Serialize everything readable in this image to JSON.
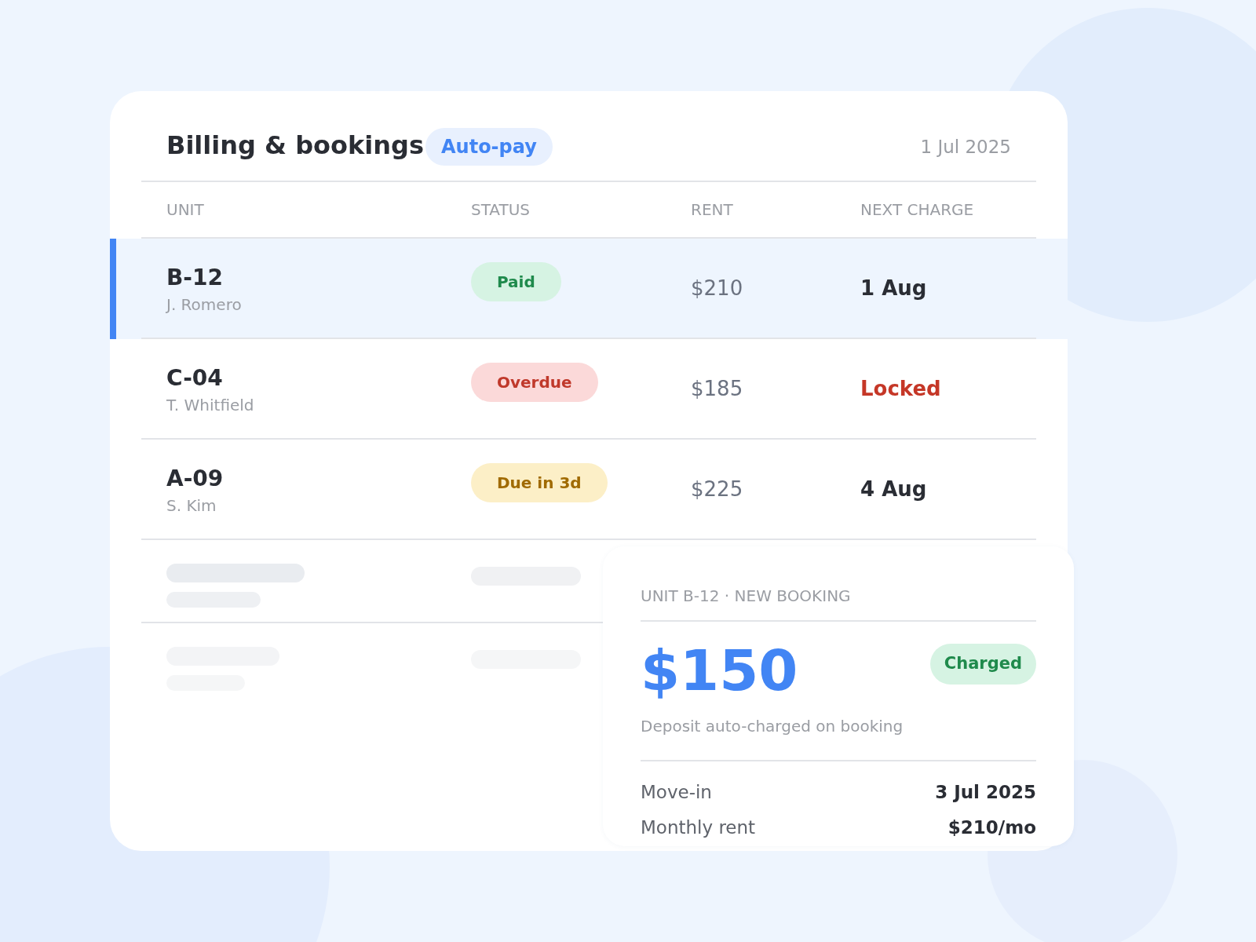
{
  "header": {
    "title": "Billing & bookings",
    "badge": "Auto-pay",
    "date": "1 Jul 2025"
  },
  "table": {
    "columns": [
      "UNIT",
      "STATUS",
      "RENT",
      "NEXT CHARGE"
    ],
    "rows": [
      {
        "unit": "B-12",
        "tenant": "J. Romero",
        "status": {
          "label": "Paid",
          "kind": "paid"
        },
        "rent": "$210",
        "next_charge": {
          "text": "1 Aug",
          "kind": "date"
        },
        "selected": true
      },
      {
        "unit": "C-04",
        "tenant": "T. Whitfield",
        "status": {
          "label": "Overdue",
          "kind": "overdue"
        },
        "rent": "$185",
        "next_charge": {
          "text": "Locked",
          "kind": "alert"
        },
        "selected": false
      },
      {
        "unit": "A-09",
        "tenant": "S. Kim",
        "status": {
          "label": "Due in 3d",
          "kind": "due"
        },
        "rent": "$225",
        "next_charge": {
          "text": "4 Aug",
          "kind": "date"
        },
        "selected": false
      }
    ],
    "loading_rows": [
      {
        "kind": "strong"
      },
      {
        "kind": "faint"
      }
    ]
  },
  "booking": {
    "label": "UNIT B-12 · NEW BOOKING",
    "amount": "$150",
    "badge": "Charged",
    "description": "Deposit auto-charged on booking",
    "details": [
      {
        "label": "Move-in",
        "value": "3 Jul 2025"
      },
      {
        "label": "Monthly rent",
        "value": "$210/mo"
      }
    ]
  }
}
